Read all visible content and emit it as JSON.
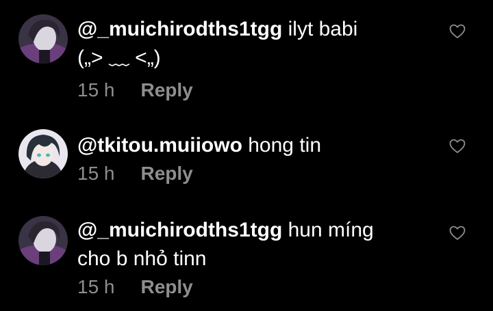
{
  "comments": [
    {
      "username": "@_muichirodths1tgg",
      "text": " ilyt babi\n(„> ﹏ <„)",
      "time": "15 h",
      "reply_label": "Reply",
      "avatar": "muichiro-avatar-1"
    },
    {
      "username": "@tkitou.muiiowo",
      "text": " hong tin",
      "time": "15 h",
      "reply_label": "Reply",
      "avatar": "muichiro-avatar-2"
    },
    {
      "username": "@_muichirodths1tgg",
      "text": " hun míng\ncho b nhỏ tinn",
      "time": "15 h",
      "reply_label": "Reply",
      "avatar": "muichiro-avatar-1"
    }
  ],
  "icons": {
    "like": "heart-outline-icon"
  },
  "colors": {
    "background": "#000000",
    "text": "#ffffff",
    "secondary": "#8e8e8e"
  }
}
